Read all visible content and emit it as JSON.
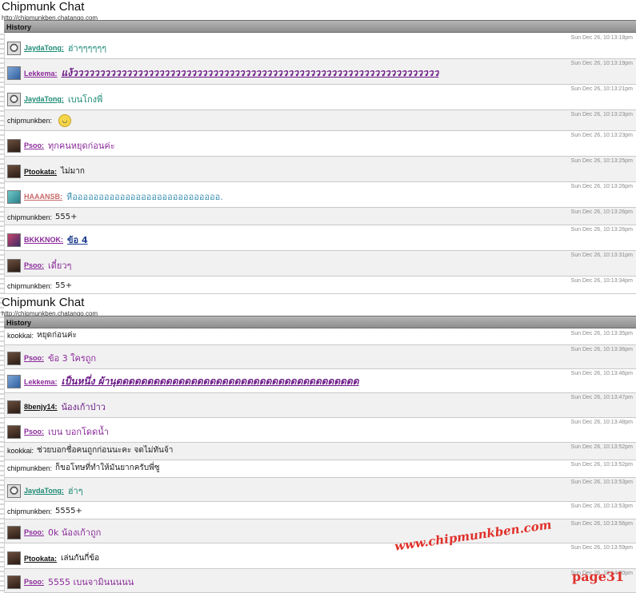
{
  "watermark": "www.chipmunkben.com",
  "page_tag": "page31",
  "screens": [
    {
      "app_title": "Chipmunk Chat",
      "app_url": "http://chipmunkben.chatango.com",
      "history_label": "History",
      "messages": [
        {
          "user": "JaydaTong:",
          "text": "ฮ่าๆๆๆๆๆๆ",
          "time": "Sun Dec 26, 10:13:18pm",
          "avatar": "av-grey",
          "name_color": "c-teal",
          "text_style": "c-teal med",
          "alt": false,
          "h": 32
        },
        {
          "user": "Lekkema:",
          "text": "แง้วววววววววววววววววววววววววววววววววววววววววววววววววววววววววววววววววววว",
          "time": "Sun Dec 26, 10:13:19pm",
          "avatar": "av-blue",
          "name_color": "c-purple",
          "text_style": "c-darkpurple big-ital",
          "alt": true,
          "h": 32
        },
        {
          "user": "JaydaTong:",
          "text": "เบนโกงพี่",
          "time": "Sun Dec 26, 10:13:21pm",
          "avatar": "av-grey",
          "name_color": "c-teal",
          "text_style": "c-teal med",
          "alt": false,
          "h": 32
        },
        {
          "user": "chipmunkben:",
          "text": "",
          "time": "Sun Dec 26, 10:13:23pm",
          "avatar": "",
          "plain": true,
          "emoji": true,
          "alt": true,
          "h": 26
        },
        {
          "user": "Psoo:",
          "text": "ทุกคนหยุดก่อนค่ะ",
          "time": "Sun Dec 26, 10:13:23pm",
          "avatar": "av-dark",
          "name_color": "c-purple",
          "text_style": "c-purple med",
          "alt": false,
          "h": 32
        },
        {
          "user": "Ptookata:",
          "text": "ไม่มาก",
          "time": "Sun Dec 26, 10:13:25pm",
          "avatar": "av-dark",
          "name_color": "c-black",
          "text_style": "c-black",
          "alt": true,
          "h": 32
        },
        {
          "user": "HAAANSB:",
          "text": "หืออออออออออออออออออออออออออออ.",
          "time": "Sun Dec 26, 10:13:26pm",
          "avatar": "av-teal",
          "name_color": "c-pink",
          "text_style": "c-cyan med",
          "alt": false,
          "h": 32
        },
        {
          "user": "chipmunkben:",
          "text": "555+",
          "time": "Sun Dec 26, 10:13:26pm",
          "avatar": "",
          "plain": true,
          "alt": true,
          "h": 22
        },
        {
          "user": "BKKKNOK:",
          "text": "ข้อ 4",
          "time": "Sun Dec 26, 10:13:26pm",
          "avatar": "av-multi",
          "name_color": "c-purple",
          "text_style": "c-navy bold-u",
          "alt": false,
          "h": 32
        },
        {
          "user": "Psoo:",
          "text": "เดี๋ยวๆ",
          "time": "Sun Dec 26, 10:13:31pm",
          "avatar": "av-dark",
          "name_color": "c-purple",
          "text_style": "c-purple med",
          "alt": true,
          "h": 32
        },
        {
          "user": "chipmunkben:",
          "text": "55+",
          "time": "Sun Dec 26, 10:13:34pm",
          "avatar": "",
          "plain": true,
          "alt": false,
          "h": 22
        }
      ]
    },
    {
      "app_title": "Chipmunk Chat",
      "app_url": "http://chipmunkben.chatango.com",
      "history_label": "History",
      "messages": [
        {
          "user": "kookkai:",
          "text": "หยุดก่อนค่ะ",
          "time": "Sun Dec 26, 10:13:35pm",
          "avatar": "",
          "plain": true,
          "alt": false,
          "h": 20
        },
        {
          "user": "Psoo:",
          "text": "ข้อ 3 ใครถูก",
          "time": "Sun Dec 26, 10:13:36pm",
          "avatar": "av-dark",
          "name_color": "c-purple",
          "text_style": "c-purple med",
          "alt": true,
          "h": 30
        },
        {
          "user": "Lekkema:",
          "text": "เป็นหนึ่ง ผ้านุดดดดดดดดดดดดดดดดดดดดดดดดดดดดดดดดดดดดดดด",
          "time": "Sun Dec 26, 10:13:46pm",
          "avatar": "av-blue",
          "name_color": "c-purple",
          "text_style": "c-darkpurple big-ital",
          "alt": false,
          "h": 30
        },
        {
          "user": "8benjy14:",
          "text": "น้องเก้าป่าว",
          "time": "Sun Dec 26, 10:13:47pm",
          "avatar": "av-dark",
          "name_color": "c-black",
          "text_style": "c-darkpurple med",
          "alt": true,
          "h": 31
        },
        {
          "user": "Psoo:",
          "text": "เบน บอกโดดน้ำ",
          "time": "Sun Dec 26, 10:13:48pm",
          "avatar": "av-dark",
          "name_color": "c-purple",
          "text_style": "c-purple med",
          "alt": false,
          "h": 31
        },
        {
          "user": "kookkai:",
          "text": "ช่วยบอกชื่อคนถูกก่อนนะคะ จดไม่ทันจ้า",
          "time": "Sun Dec 26, 10:13:52pm",
          "avatar": "",
          "plain": true,
          "alt": true,
          "h": 22
        },
        {
          "user": "chipmunkben:",
          "text": "ก็ขอโทษที่ทำให้มันยากครับพี่ซู",
          "time": "Sun Dec 26, 10:13:52pm",
          "avatar": "",
          "plain": true,
          "alt": false,
          "h": 22
        },
        {
          "user": "JaydaTong:",
          "text": "ฮ่าๆ",
          "time": "Sun Dec 26, 10:13:53pm",
          "avatar": "av-grey",
          "name_color": "c-teal",
          "text_style": "c-teal med",
          "alt": true,
          "h": 30
        },
        {
          "user": "chipmunkben:",
          "text": "5555+",
          "time": "Sun Dec 26, 10:13:53pm",
          "avatar": "",
          "plain": true,
          "alt": false,
          "h": 22
        },
        {
          "user": "Psoo:",
          "text": "0k น้องเก้าถูก",
          "time": "Sun Dec 26, 10:13:56pm",
          "avatar": "av-dark",
          "name_color": "c-purple",
          "text_style": "c-purple med",
          "alt": true,
          "h": 30
        },
        {
          "user": "Ptookata:",
          "text": "เล่นกันกี่ข้อ",
          "time": "Sun Dec 26, 10:13:59pm",
          "avatar": "av-dark",
          "name_color": "c-black",
          "text_style": "c-black",
          "alt": false,
          "h": 32
        },
        {
          "user": "Psoo:",
          "text": "5555 เบนจามินนนนน",
          "time": "Sun Dec 26, 10:14:00pm",
          "avatar": "av-dark",
          "name_color": "c-purple",
          "text_style": "c-purple med",
          "alt": true,
          "h": 30
        }
      ]
    }
  ]
}
